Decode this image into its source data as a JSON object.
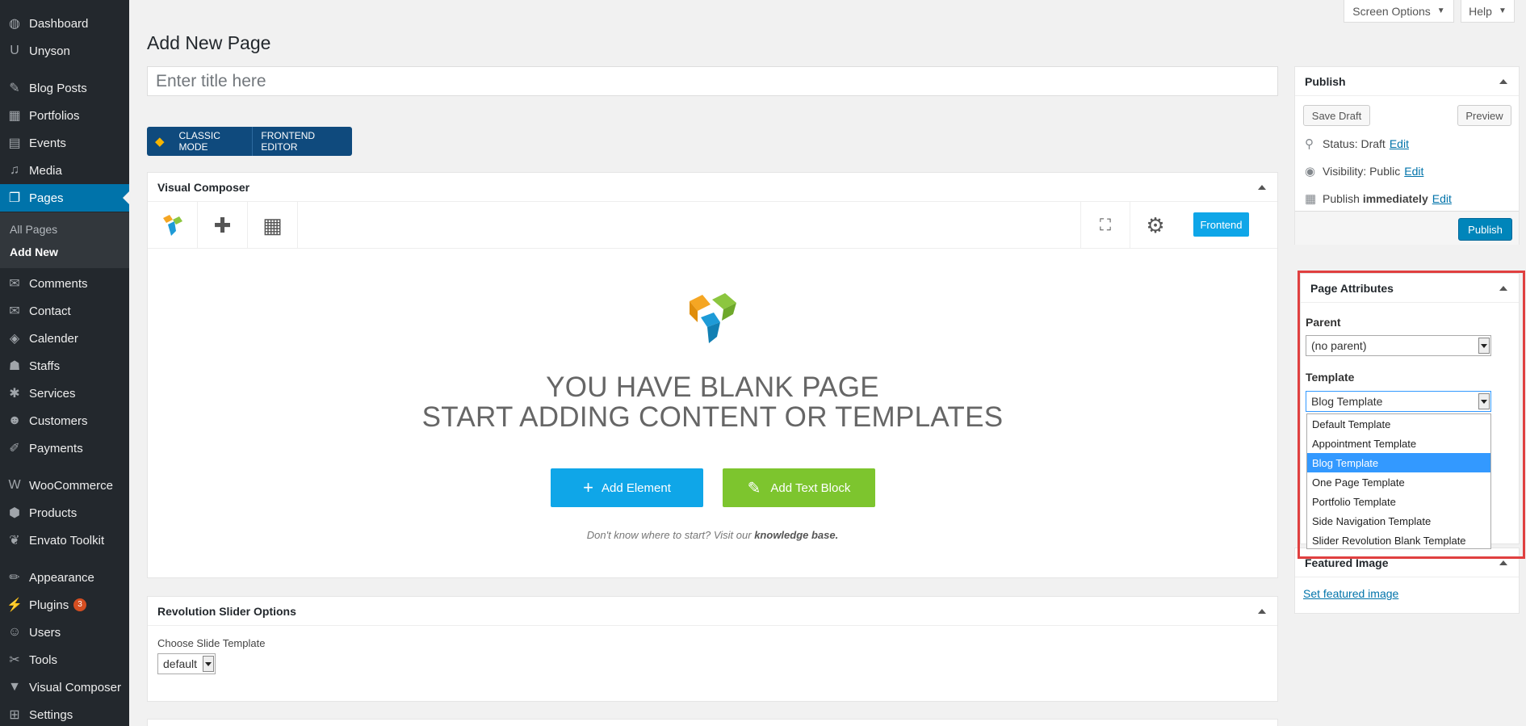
{
  "sidebar": {
    "items": [
      {
        "label": "Dashboard",
        "icon": "dashboard-icon",
        "glyph": "◍"
      },
      {
        "label": "Unyson",
        "icon": "unyson-icon",
        "glyph": "U"
      },
      {
        "label": "Blog Posts",
        "icon": "pin-icon",
        "glyph": "✎"
      },
      {
        "label": "Portfolios",
        "icon": "portfolio-icon",
        "glyph": "▦"
      },
      {
        "label": "Events",
        "icon": "calendar-icon",
        "glyph": "▤"
      },
      {
        "label": "Media",
        "icon": "media-icon",
        "glyph": "♫"
      },
      {
        "label": "Pages",
        "icon": "pages-icon",
        "glyph": "❐"
      },
      {
        "label": "Comments",
        "icon": "comments-icon",
        "glyph": "✉"
      },
      {
        "label": "Contact",
        "icon": "mail-icon",
        "glyph": "✉"
      },
      {
        "label": "Calender",
        "icon": "tag-icon",
        "glyph": "◈"
      },
      {
        "label": "Staffs",
        "icon": "users-icon",
        "glyph": "☗"
      },
      {
        "label": "Services",
        "icon": "services-icon",
        "glyph": "✱"
      },
      {
        "label": "Customers",
        "icon": "customers-icon",
        "glyph": "☻"
      },
      {
        "label": "Payments",
        "icon": "payments-icon",
        "glyph": "✐"
      },
      {
        "label": "WooCommerce",
        "icon": "woocommerce-icon",
        "glyph": "W"
      },
      {
        "label": "Products",
        "icon": "products-icon",
        "glyph": "⬢"
      },
      {
        "label": "Envato Toolkit",
        "icon": "envato-icon",
        "glyph": "❦"
      },
      {
        "label": "Appearance",
        "icon": "appearance-icon",
        "glyph": "✏"
      },
      {
        "label": "Plugins",
        "icon": "plugins-icon",
        "glyph": "⚡",
        "badge": "3"
      },
      {
        "label": "Users",
        "icon": "user-icon",
        "glyph": "☺"
      },
      {
        "label": "Tools",
        "icon": "tools-icon",
        "glyph": "✂"
      },
      {
        "label": "Visual Composer",
        "icon": "visual-composer-icon",
        "glyph": "▼"
      },
      {
        "label": "Settings",
        "icon": "settings-icon",
        "glyph": "⊞"
      }
    ],
    "submenu": [
      "All Pages",
      "Add New"
    ]
  },
  "topbar": {
    "screen_options": "Screen Options",
    "help": "Help"
  },
  "page_title": "Add New Page",
  "title_placeholder": "Enter title here",
  "vc_modes": {
    "classic": "CLASSIC MODE",
    "frontend": "FRONTEND EDITOR"
  },
  "vc_box": {
    "title": "Visual Composer",
    "frontend_button": "Frontend",
    "blank_line1": "YOU HAVE BLANK PAGE",
    "blank_line2": "START ADDING CONTENT OR TEMPLATES",
    "add_element": "Add Element",
    "add_text_block": "Add Text Block",
    "kb_prefix": "Don't know where to start? Visit our",
    "kb_link": "knowledge base."
  },
  "slider_box": {
    "title": "Revolution Slider Options",
    "label": "Choose Slide Template",
    "value": "default"
  },
  "publish_box": {
    "title": "Publish",
    "save_draft": "Save Draft",
    "preview": "Preview",
    "status_label": "Status:",
    "status_value": "Draft",
    "visibility_label": "Visibility:",
    "visibility_value": "Public",
    "publish_label": "Publish",
    "publish_value": "immediately",
    "edit": "Edit",
    "publish_button": "Publish"
  },
  "attributes_box": {
    "title": "Page Attributes",
    "parent_label": "Parent",
    "parent_value": "(no parent)",
    "template_label": "Template",
    "template_value": "Blog Template",
    "template_options": [
      "Default Template",
      "Appointment Template",
      "Blog Template",
      "One Page Template",
      "Portfolio Template",
      "Side Navigation Template",
      "Slider Revolution Blank Template"
    ],
    "selected_index": 2
  },
  "featured_box": {
    "title": "Featured Image",
    "link": "Set featured image"
  },
  "colors": {
    "accent": "#0073aa",
    "sidebar": "#23282d",
    "vc_blue": "#0fa6e8",
    "vc_green": "#7dc52e",
    "highlight": "#e04040"
  }
}
